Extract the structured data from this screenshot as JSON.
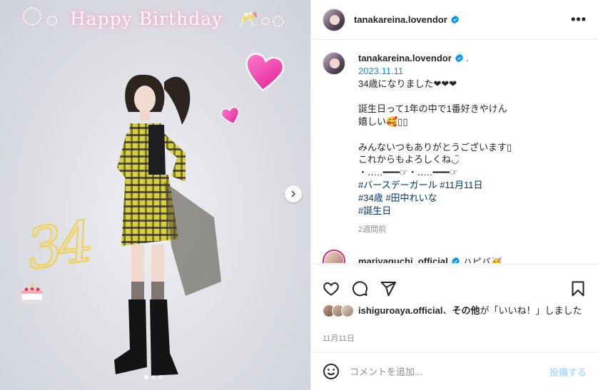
{
  "post": {
    "username": "tanakareina.lovendor",
    "more_label": "•••"
  },
  "image": {
    "overlay_text": "Happy Birthday",
    "age_text": "34",
    "carousel_dots": 3,
    "active_dot": 1
  },
  "caption": {
    "username": "tanakareina.lovendor",
    "suffix": ".",
    "date": "2023.11.11",
    "lines": [
      "34歳になりました❤︎❤︎❤︎",
      "",
      "誕生日って1年の中で1番好きやけん",
      "嬉しい🥰▯▯",
      "",
      "みんないつもありがとうございます▯",
      "これからもよろしくね◡̈",
      "・‥…━━━☞・‥…━━━☞"
    ],
    "hashtags_line1": [
      "#バースデーガール",
      "#11月11日"
    ],
    "hashtags_line2": [
      "#34歳",
      "#田中れいな"
    ],
    "hashtags_line3": [
      "#誕生日"
    ],
    "time_ago": "2週間前"
  },
  "comment": {
    "username": "mariyaguchi_official",
    "text": "ハピバ🥳"
  },
  "likes": {
    "first_user": "ishiguroaya.official",
    "sep": "、",
    "others": "その他",
    "rest": "が「いいね！」しました"
  },
  "post_date": "11月11日",
  "add_comment": {
    "placeholder": "コメントを追加...",
    "post_label": "投稿する"
  },
  "colors": {
    "link": "#0095f6",
    "hashtag": "#00376b",
    "muted": "#8e8e8e",
    "verified": "#0095f6"
  }
}
